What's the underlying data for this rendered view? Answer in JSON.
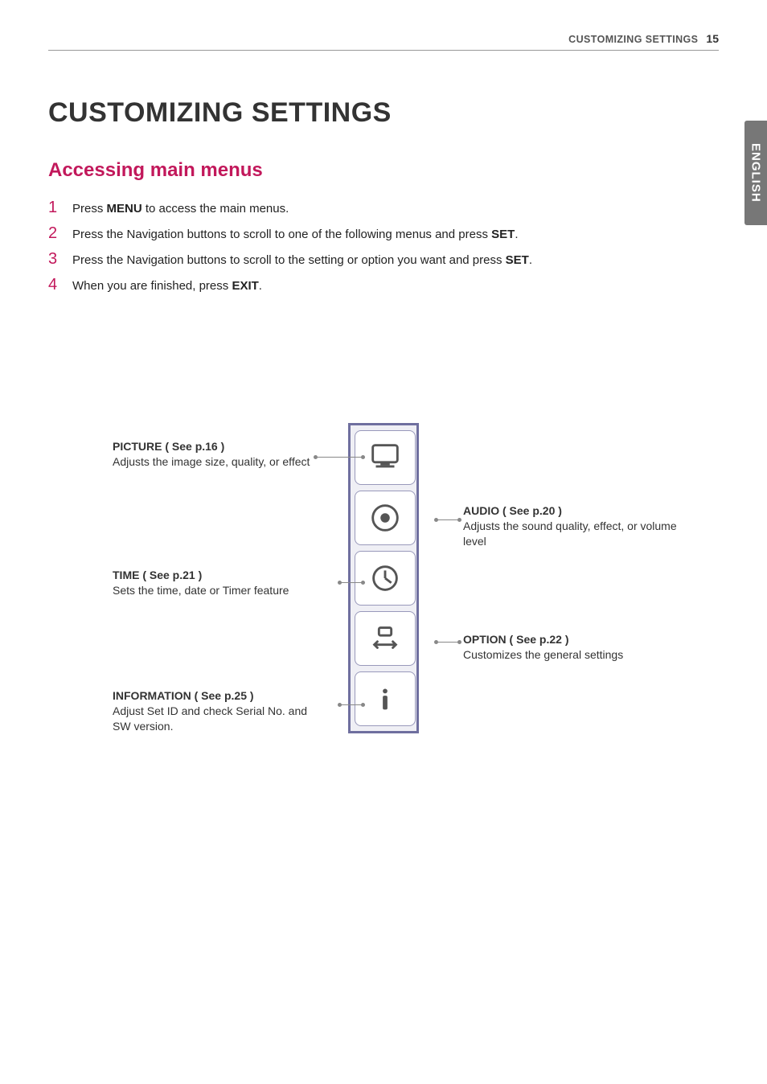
{
  "header": {
    "section": "CUSTOMIZING SETTINGS",
    "page": "15"
  },
  "language_tab": "ENGLISH",
  "title": "CUSTOMIZING SETTINGS",
  "subtitle": "Accessing main menus",
  "steps": [
    {
      "num": "1",
      "pre": "Press ",
      "bold": "MENU",
      "post": " to access the main menus."
    },
    {
      "num": "2",
      "pre": "Press the Navigation buttons to scroll to one of the following menus and press ",
      "bold": "SET",
      "post": "."
    },
    {
      "num": "3",
      "pre": "Press the Navigation buttons to scroll to the setting or option you want and press ",
      "bold": "SET",
      "post": "."
    },
    {
      "num": "4",
      "pre": "When you are finished, press ",
      "bold": "EXIT",
      "post": "."
    }
  ],
  "menus": {
    "picture": {
      "title": "PICTURE ( See p.16 )",
      "desc": "Adjusts the image size, quality, or effect"
    },
    "audio": {
      "title": "AUDIO ( See p.20 )",
      "desc": "Adjusts the sound quality, effect, or volume level"
    },
    "time": {
      "title": "TIME ( See p.21 )",
      "desc": "Sets the time, date or Timer feature"
    },
    "option": {
      "title": "OPTION ( See p.22 )",
      "desc": "Customizes the general settings"
    },
    "information": {
      "title": "INFORMATION ( See p.25 )",
      "desc": "Adjust Set ID and check Serial No. and SW version."
    }
  }
}
